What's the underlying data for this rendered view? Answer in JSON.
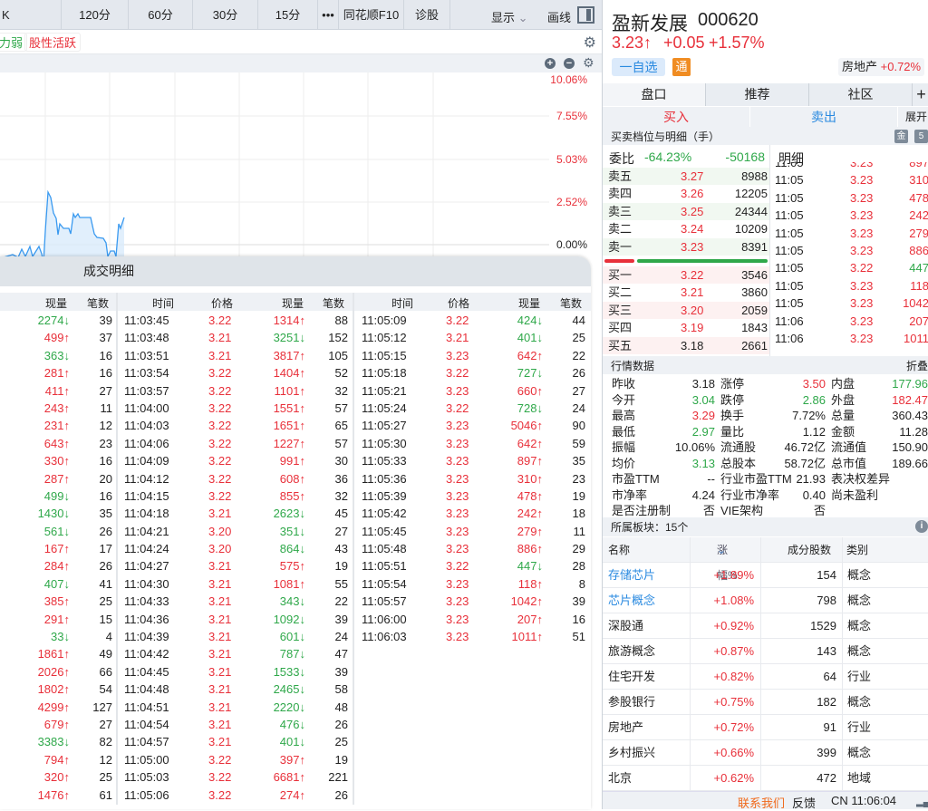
{
  "toolbar": {
    "items": [
      "K",
      "120分",
      "60分",
      "30分",
      "15分",
      "•••",
      "同花顺F10",
      "诊股"
    ],
    "display": "显示",
    "draw": "画线"
  },
  "tags": {
    "weak": "力弱",
    "active": "股性活跃"
  },
  "chart": {
    "y_labels": [
      "10.06%",
      "7.55%",
      "5.03%",
      "2.52%",
      "0.00%"
    ]
  },
  "trades": {
    "title": "成交明细",
    "headers": {
      "time": "时间",
      "price": "价格",
      "volume": "现量",
      "count": "笔数"
    },
    "col1": [
      [
        "",
        "",
        "2274↓",
        "39"
      ],
      [
        "",
        "",
        "499↑",
        "37"
      ],
      [
        "",
        "",
        "363↓",
        "16"
      ],
      [
        "",
        "",
        "281↑",
        "16"
      ],
      [
        "",
        "",
        "411↑",
        "27"
      ],
      [
        "",
        "",
        "243↑",
        "11"
      ],
      [
        "",
        "",
        "231↑",
        "12"
      ],
      [
        "",
        "",
        "643↑",
        "23"
      ],
      [
        "",
        "",
        "330↑",
        "16"
      ],
      [
        "",
        "",
        "287↑",
        "20"
      ],
      [
        "",
        "",
        "499↓",
        "16"
      ],
      [
        "",
        "",
        "1430↓",
        "35"
      ],
      [
        "",
        "",
        "561↓",
        "26"
      ],
      [
        "",
        "",
        "167↑",
        "17"
      ],
      [
        "",
        "",
        "284↑",
        "26"
      ],
      [
        "",
        "",
        "407↓",
        "41"
      ],
      [
        "",
        "",
        "385↑",
        "25"
      ],
      [
        "",
        "",
        "291↑",
        "15"
      ],
      [
        "",
        "",
        "33↓",
        "4"
      ],
      [
        "",
        "",
        "1861↑",
        "49"
      ],
      [
        "",
        "",
        "2026↑",
        "66"
      ],
      [
        "",
        "",
        "1802↑",
        "54"
      ],
      [
        "",
        "",
        "4299↑",
        "127"
      ],
      [
        "",
        "",
        "679↑",
        "27"
      ],
      [
        "",
        "",
        "3383↓",
        "82"
      ],
      [
        "",
        "",
        "794↑",
        "12"
      ],
      [
        "",
        "",
        "320↑",
        "25"
      ],
      [
        "",
        "",
        "1476↑",
        "61"
      ]
    ],
    "col2": [
      [
        "11:03:45",
        "3.22",
        "1314↑",
        "88"
      ],
      [
        "11:03:48",
        "3.21",
        "3251↓",
        "152"
      ],
      [
        "11:03:51",
        "3.21",
        "3817↑",
        "105"
      ],
      [
        "11:03:54",
        "3.22",
        "1404↑",
        "52"
      ],
      [
        "11:03:57",
        "3.22",
        "1101↑",
        "32"
      ],
      [
        "11:04:00",
        "3.22",
        "1551↑",
        "57"
      ],
      [
        "11:04:03",
        "3.22",
        "1651↑",
        "65"
      ],
      [
        "11:04:06",
        "3.22",
        "1227↑",
        "57"
      ],
      [
        "11:04:09",
        "3.22",
        "991↑",
        "30"
      ],
      [
        "11:04:12",
        "3.22",
        "608↑",
        "36"
      ],
      [
        "11:04:15",
        "3.22",
        "855↑",
        "32"
      ],
      [
        "11:04:18",
        "3.21",
        "2623↓",
        "45"
      ],
      [
        "11:04:21",
        "3.20",
        "351↓",
        "27"
      ],
      [
        "11:04:24",
        "3.20",
        "864↓",
        "43"
      ],
      [
        "11:04:27",
        "3.21",
        "575↑",
        "19"
      ],
      [
        "11:04:30",
        "3.21",
        "1081↑",
        "55"
      ],
      [
        "11:04:33",
        "3.21",
        "343↓",
        "22"
      ],
      [
        "11:04:36",
        "3.21",
        "1092↓",
        "39"
      ],
      [
        "11:04:39",
        "3.21",
        "601↓",
        "24"
      ],
      [
        "11:04:42",
        "3.21",
        "787↓",
        "47"
      ],
      [
        "11:04:45",
        "3.21",
        "1533↓",
        "39"
      ],
      [
        "11:04:48",
        "3.21",
        "2465↓",
        "58"
      ],
      [
        "11:04:51",
        "3.21",
        "2220↓",
        "48"
      ],
      [
        "11:04:54",
        "3.21",
        "476↓",
        "26"
      ],
      [
        "11:04:57",
        "3.21",
        "401↓",
        "25"
      ],
      [
        "11:05:00",
        "3.22",
        "397↑",
        "19"
      ],
      [
        "11:05:03",
        "3.22",
        "6681↑",
        "221"
      ],
      [
        "11:05:06",
        "3.22",
        "274↑",
        "26"
      ]
    ],
    "col3": [
      [
        "11:05:09",
        "3.22",
        "424↓",
        "44"
      ],
      [
        "11:05:12",
        "3.21",
        "401↓",
        "25"
      ],
      [
        "11:05:15",
        "3.23",
        "642↑",
        "22"
      ],
      [
        "11:05:18",
        "3.22",
        "727↓",
        "26"
      ],
      [
        "11:05:21",
        "3.23",
        "660↑",
        "27"
      ],
      [
        "11:05:24",
        "3.22",
        "728↓",
        "24"
      ],
      [
        "11:05:27",
        "3.23",
        "5046↑",
        "90"
      ],
      [
        "11:05:30",
        "3.23",
        "642↑",
        "59"
      ],
      [
        "11:05:33",
        "3.23",
        "897↑",
        "35"
      ],
      [
        "11:05:36",
        "3.23",
        "310↑",
        "23"
      ],
      [
        "11:05:39",
        "3.23",
        "478↑",
        "19"
      ],
      [
        "11:05:42",
        "3.23",
        "242↑",
        "18"
      ],
      [
        "11:05:45",
        "3.23",
        "279↑",
        "11"
      ],
      [
        "11:05:48",
        "3.23",
        "886↑",
        "29"
      ],
      [
        "11:05:51",
        "3.22",
        "447↓",
        "28"
      ],
      [
        "11:05:54",
        "3.23",
        "118↑",
        "8"
      ],
      [
        "11:05:57",
        "3.23",
        "1042↑",
        "39"
      ],
      [
        "11:06:00",
        "3.23",
        "207↑",
        "16"
      ],
      [
        "11:06:03",
        "3.23",
        "1011↑",
        "51"
      ]
    ]
  },
  "stock": {
    "name": "盈新发展",
    "code": "000620",
    "price": "3.23↑",
    "change": "+0.05",
    "pct": "+1.57%",
    "watch": "一自选",
    "tong": "通",
    "sector": "房地产",
    "sector_pct": "+0.72%"
  },
  "tabs": [
    "盘口",
    "推荐",
    "社区",
    "+"
  ],
  "trade_buttons": {
    "buy": "买入",
    "sell": "卖出",
    "expand": "展开"
  },
  "book": {
    "title": "买卖档位与明细（手）",
    "badge1": "金",
    "badge2": "5",
    "weibi_label": "委比",
    "weibi_pct": "-64.23%",
    "weibi_val": "-50168",
    "detail_label": "明细",
    "asks": [
      [
        "卖五",
        "3.27",
        "8988"
      ],
      [
        "卖四",
        "3.26",
        "12205"
      ],
      [
        "卖三",
        "3.25",
        "24344"
      ],
      [
        "卖二",
        "3.24",
        "10209"
      ],
      [
        "卖一",
        "3.23",
        "8391"
      ]
    ],
    "bids": [
      [
        "买一",
        "3.22",
        "3546"
      ],
      [
        "买二",
        "3.21",
        "3860"
      ],
      [
        "买三",
        "3.20",
        "2059"
      ],
      [
        "买四",
        "3.19",
        "1843"
      ],
      [
        "买五",
        "3.18",
        "2661"
      ]
    ],
    "ratio_buy": 0.41,
    "ticks": [
      [
        "11:05",
        "3.23",
        "897",
        "r"
      ],
      [
        "11:05",
        "3.23",
        "310",
        "r"
      ],
      [
        "11:05",
        "3.23",
        "478",
        "r"
      ],
      [
        "11:05",
        "3.23",
        "242",
        "r"
      ],
      [
        "11:05",
        "3.23",
        "279",
        "r"
      ],
      [
        "11:05",
        "3.23",
        "886",
        "r"
      ],
      [
        "11:05",
        "3.22",
        "447",
        "g"
      ],
      [
        "11:05",
        "3.23",
        "118",
        "r"
      ],
      [
        "11:05",
        "3.23",
        "1042",
        "r"
      ],
      [
        "11:06",
        "3.23",
        "207",
        "r"
      ],
      [
        "11:06",
        "3.23",
        "1011",
        "r"
      ]
    ]
  },
  "market": {
    "title": "行情数据",
    "fold": "折叠",
    "rows": [
      [
        [
          "昨收",
          "3.18",
          ""
        ],
        [
          "涨停",
          "3.50",
          "r"
        ],
        [
          "内盘",
          "177.96万",
          "g"
        ]
      ],
      [
        [
          "今开",
          "3.04",
          "g"
        ],
        [
          "跌停",
          "2.86",
          "g"
        ],
        [
          "外盘",
          "182.47万",
          "r"
        ]
      ],
      [
        [
          "最高",
          "3.29",
          "r"
        ],
        [
          "换手",
          "7.72%",
          ""
        ],
        [
          "总量",
          "360.43万",
          ""
        ]
      ],
      [
        [
          "最低",
          "2.97",
          "g"
        ],
        [
          "量比",
          "1.12",
          ""
        ],
        [
          "金额",
          "11.28亿",
          ""
        ]
      ],
      [
        [
          "振幅",
          "10.06%",
          ""
        ],
        [
          "流通股",
          "46.72亿",
          ""
        ],
        [
          "流通值",
          "150.90亿",
          ""
        ]
      ],
      [
        [
          "均价",
          "3.13",
          "g"
        ],
        [
          "总股本",
          "58.72亿",
          ""
        ],
        [
          "总市值",
          "189.66亿",
          ""
        ]
      ],
      [
        [
          "市盈TTM",
          "--",
          ""
        ],
        [
          "行业市盈TTM",
          "21.93",
          ""
        ],
        [
          "表决权差异",
          "否",
          ""
        ]
      ],
      [
        [
          "市净率",
          "4.24",
          ""
        ],
        [
          "行业市净率",
          "0.40",
          ""
        ],
        [
          "尚未盈利",
          "否",
          ""
        ]
      ],
      [
        [
          "是否注册制",
          "否",
          ""
        ],
        [
          "VIE架构",
          "否",
          ""
        ],
        [
          "",
          "",
          ""
        ]
      ]
    ]
  },
  "sectors": {
    "title": "所属板块：15个",
    "headers": [
      "名称",
      "涨幅%",
      "成分股数",
      "类别"
    ],
    "rows": [
      [
        "存储芯片",
        "+1.89%",
        "154",
        "概念"
      ],
      [
        "芯片概念",
        "+1.08%",
        "798",
        "概念"
      ],
      [
        "深股通",
        "+0.92%",
        "1529",
        "概念"
      ],
      [
        "旅游概念",
        "+0.87%",
        "143",
        "概念"
      ],
      [
        "住宅开发",
        "+0.82%",
        "64",
        "行业"
      ],
      [
        "参股银行",
        "+0.75%",
        "182",
        "概念"
      ],
      [
        "房地产",
        "+0.72%",
        "91",
        "行业"
      ],
      [
        "乡村振兴",
        "+0.66%",
        "399",
        "概念"
      ],
      [
        "北京",
        "+0.62%",
        "472",
        "地域"
      ]
    ]
  },
  "status": {
    "contact": "联系我们",
    "feedback": "反馈",
    "clock": "CN 11:06:04"
  }
}
